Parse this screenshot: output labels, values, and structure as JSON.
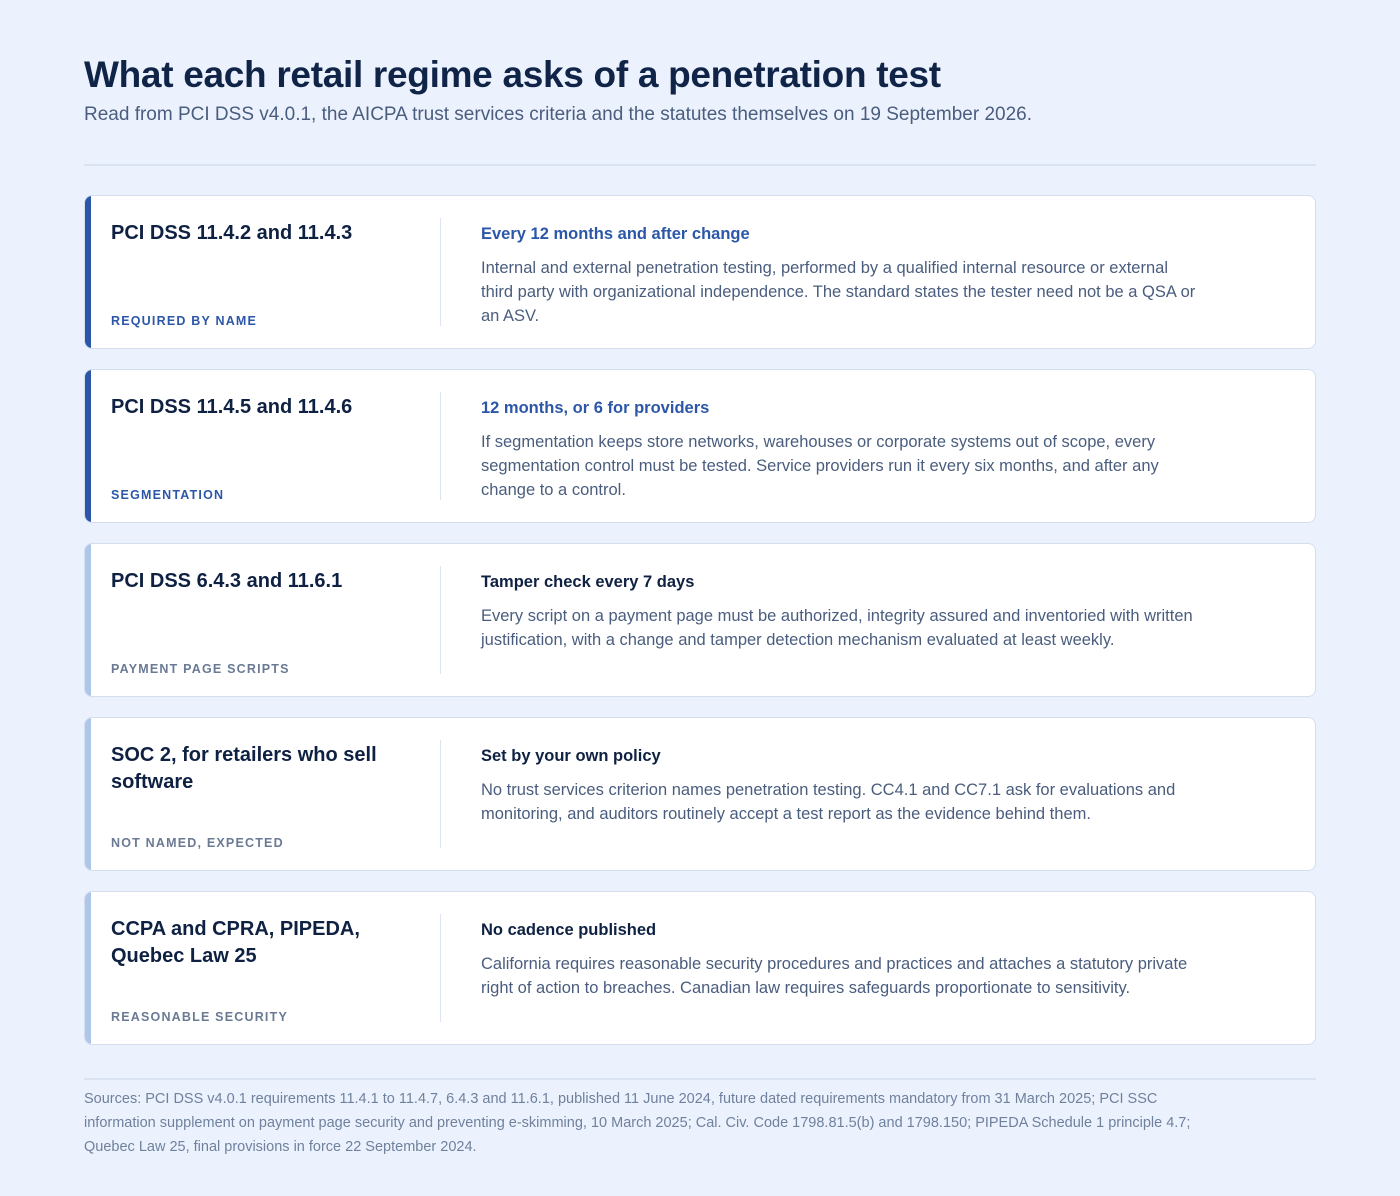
{
  "header": {
    "title": "What each retail regime asks of a penetration test",
    "subtitle": "Read from PCI DSS v4.0.1, the AICPA trust services criteria and the statutes themselves on 19 September 2026."
  },
  "colors": {
    "background": "#ebf2fd",
    "accent_strong": "#2c57a8",
    "accent_soft": "#aec6e8",
    "heading": "#0f2142",
    "body_text": "#4a5d7e"
  },
  "regimes": [
    {
      "name": "PCI DSS 11.4.2 and 11.4.3",
      "tag": "REQUIRED BY NAME",
      "cadence": "Every 12 months and after change",
      "description": "Internal and external penetration testing, performed by a qualified internal resource or external third party with organizational independence. The standard states the tester need not be a QSA or an ASV.",
      "emphasis": "strong"
    },
    {
      "name": "PCI DSS 11.4.5 and 11.4.6",
      "tag": "SEGMENTATION",
      "cadence": "12 months, or 6 for providers",
      "description": "If segmentation keeps store networks, warehouses or corporate systems out of scope, every segmentation control must be tested. Service providers run it every six months, and after any change to a control.",
      "emphasis": "strong"
    },
    {
      "name": "PCI DSS 6.4.3 and 11.6.1",
      "tag": "PAYMENT PAGE SCRIPTS",
      "cadence": "Tamper check every 7 days",
      "description": "Every script on a payment page must be authorized, integrity assured and inventoried with written justification, with a change and tamper detection mechanism evaluated at least weekly.",
      "emphasis": "soft"
    },
    {
      "name": "SOC 2, for retailers who sell software",
      "tag": "NOT NAMED, EXPECTED",
      "cadence": "Set by your own policy",
      "description": "No trust services criterion names penetration testing. CC4.1 and CC7.1 ask for evaluations and monitoring, and auditors routinely accept a test report as the evidence behind them.",
      "emphasis": "soft"
    },
    {
      "name": "CCPA and CPRA, PIPEDA, Quebec Law 25",
      "tag": "REASONABLE SECURITY",
      "cadence": "No cadence published",
      "description": "California requires reasonable security procedures and practices and attaches a statutory private right of action to breaches. Canadian law requires safeguards proportionate to sensitivity.",
      "emphasis": "soft"
    }
  ],
  "footer": {
    "sources": "Sources: PCI DSS v4.0.1 requirements 11.4.1 to 11.4.7, 6.4.3 and 11.6.1, published 11 June 2024, future dated requirements mandatory from 31 March 2025; PCI SSC information supplement on payment page security and preventing e-skimming, 10 March 2025; Cal. Civ. Code 1798.81.5(b) and 1798.150; PIPEDA Schedule 1 principle 4.7; Quebec Law 25, final provisions in force 22 September 2024."
  }
}
